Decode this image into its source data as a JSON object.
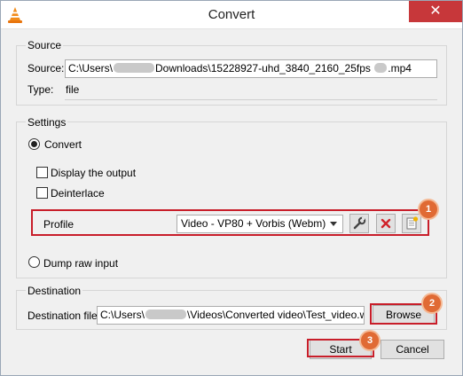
{
  "window": {
    "title": "Convert",
    "close_glyph": "✕",
    "app_icon": "vlc-cone-icon"
  },
  "source": {
    "group_title": "Source",
    "source_label": "Source:",
    "path_prefix": "C:\\Users\\",
    "path_middle": "Downloads\\15228927-uhd_3840_2160_25fps",
    "path_suffix": ".mp4",
    "type_label": "Type:",
    "type_value": "file"
  },
  "settings": {
    "group_title": "Settings",
    "convert_label": "Convert",
    "convert_selected": true,
    "display_output_label": "Display the output",
    "display_output_checked": false,
    "deinterlace_label": "Deinterlace",
    "deinterlace_checked": false,
    "profile_label": "Profile",
    "profile_value": "Video - VP80 + Vorbis (Webm)",
    "dump_raw_label": "Dump raw input",
    "dump_raw_selected": false,
    "edit_profile_icon": "wrench-icon",
    "delete_profile_icon": "delete-x-icon",
    "new_profile_icon": "new-profile-icon"
  },
  "destination": {
    "group_title": "Destination",
    "file_label": "Destination file:",
    "path_prefix": "C:\\Users\\",
    "path_suffix": "\\Videos\\Converted video\\Test_video.webm",
    "browse_label": "Browse"
  },
  "actions": {
    "start_label": "Start",
    "cancel_label": "Cancel"
  },
  "annotations": {
    "marker_1": "1",
    "marker_2": "2",
    "marker_3": "3",
    "highlight_color": "#c81e2a",
    "marker_color": "#e06a34"
  }
}
